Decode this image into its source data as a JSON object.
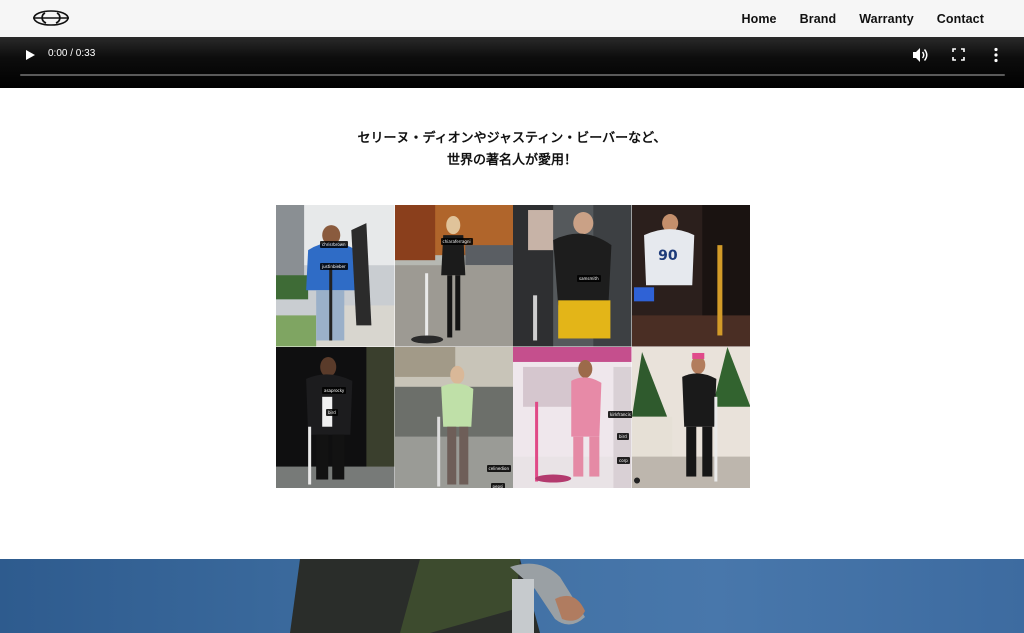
{
  "header": {
    "logo_icon": "brand-logo-icon",
    "nav": [
      {
        "label": "Home"
      },
      {
        "label": "Brand"
      },
      {
        "label": "Warranty"
      },
      {
        "label": "Contact"
      }
    ]
  },
  "video_player": {
    "time": "0:00 / 0:33",
    "progress": 0,
    "icons": [
      "play-icon",
      "volume-icon",
      "fullscreen-icon",
      "more-options-icon"
    ]
  },
  "main": {
    "headline_line1": "セリーヌ・ディオンやジャスティン・ビーバーなど、",
    "headline_line2": "世界の著名人が愛用！",
    "celebrity_photos": [
      {
        "tags": [
          "chrisrbrown",
          "justinbieber"
        ]
      },
      {
        "tags": [
          "chiaraferragni"
        ]
      },
      {
        "tags": [
          "samsmith"
        ]
      },
      {
        "tags": []
      },
      {
        "tags": [
          "asaprocky",
          "bird"
        ]
      },
      {
        "tags": [
          "celinedion",
          "pepsi"
        ]
      },
      {
        "tags": [
          "kirkfrancis",
          "bird",
          "corp"
        ]
      },
      {
        "tags": []
      }
    ]
  },
  "colors": {
    "header_bg": "#f6f6f6",
    "video_bg": "#000000",
    "hero_sky": "#3f6fa2"
  }
}
